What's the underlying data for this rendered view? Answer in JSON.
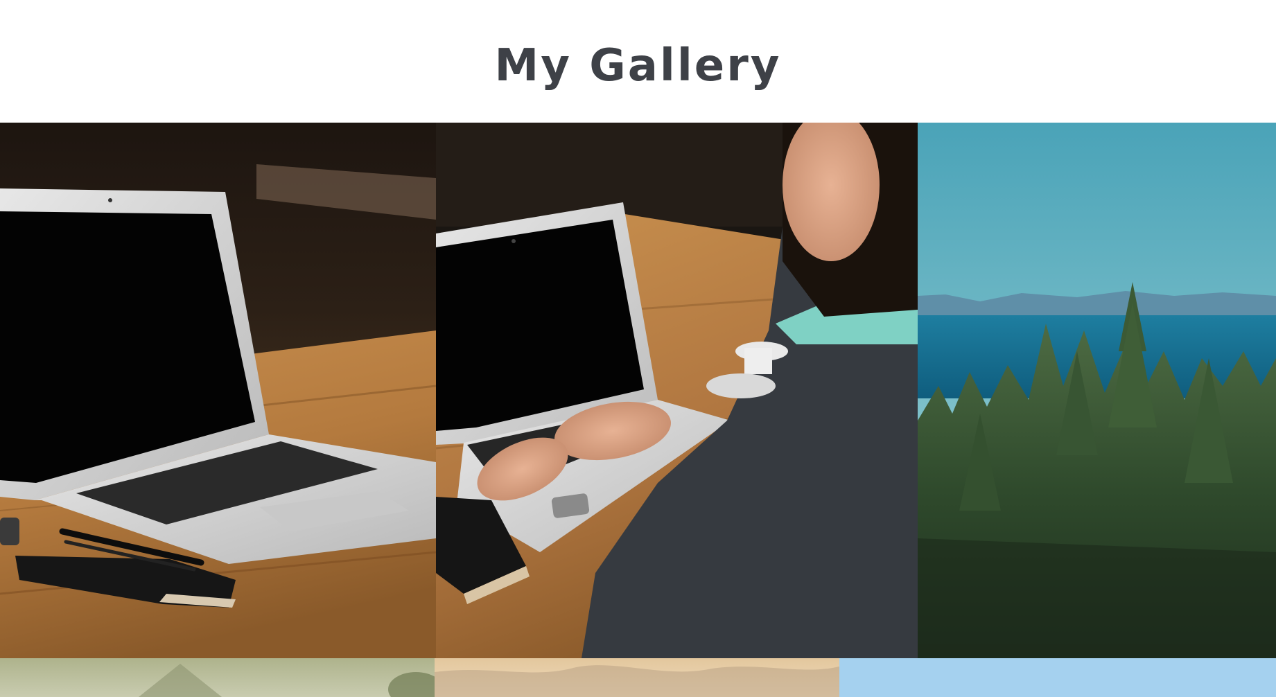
{
  "page": {
    "title": "My Gallery"
  },
  "gallery": {
    "photos": [
      {
        "id": "laptop-on-table",
        "icon": "image-icon"
      },
      {
        "id": "person-typing-laptop",
        "icon": "image-icon"
      },
      {
        "id": "forest-and-sea",
        "icon": "image-icon"
      },
      {
        "id": "hazy-hills",
        "icon": "image-icon"
      },
      {
        "id": "sunset-clouds",
        "icon": "image-icon"
      },
      {
        "id": "blue-sky",
        "icon": "image-icon"
      }
    ]
  },
  "colors": {
    "title": "#3e4147",
    "background": "#ffffff"
  }
}
